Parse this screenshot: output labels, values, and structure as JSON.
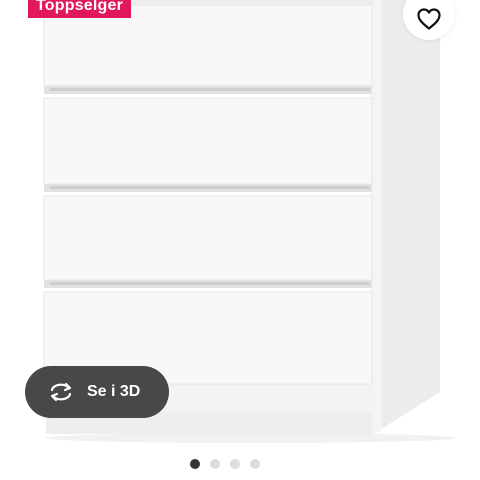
{
  "product": {
    "badge": "Toppselger",
    "favourite_icon": "heart-outline-icon",
    "view3d": {
      "label": "Se i 3D",
      "icon": "rotate-arrows-icon"
    },
    "carousel": {
      "total_images": 4,
      "active_index": 0
    }
  },
  "colors": {
    "badge_bg": "#e3175d",
    "button_dark": "#484848",
    "dot_active": "#333333",
    "dot_inactive": "#dcdcdc"
  }
}
